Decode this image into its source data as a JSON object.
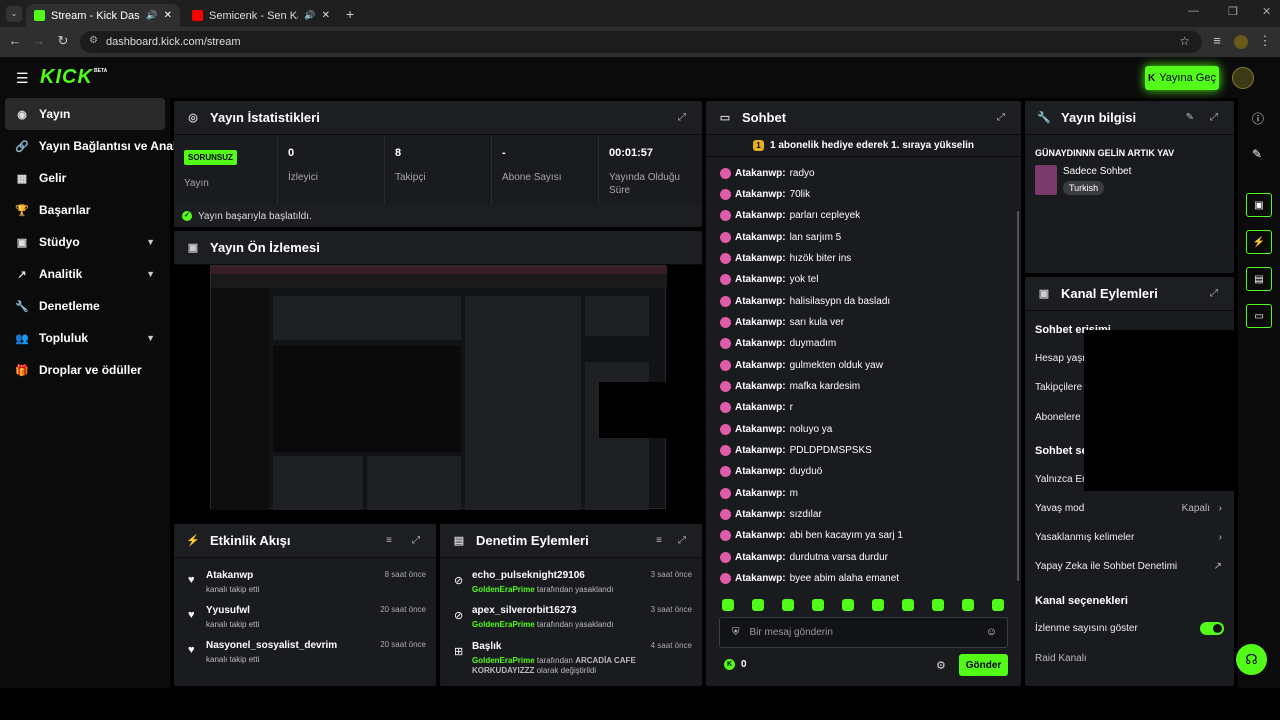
{
  "browser": {
    "tabs": [
      {
        "title": "Stream - Kick Dashboard",
        "favicon_color": "#53fc18"
      },
      {
        "title": "Semicenk - Sen Kaldın (Lyric",
        "favicon_color": "#ff0000"
      }
    ],
    "url": "dashboard.kick.com/stream"
  },
  "header": {
    "logo": "KICK",
    "beta": "BETA",
    "go_live": "Yayına Geç"
  },
  "sidebar": {
    "items": [
      {
        "label": "Yayın",
        "icon": "broadcast-icon"
      },
      {
        "label": "Yayın Bağlantısı ve Anahtarı",
        "icon": "link-icon"
      },
      {
        "label": "Gelir",
        "icon": "chart-icon"
      },
      {
        "label": "Başarılar",
        "icon": "trophy-icon"
      },
      {
        "label": "Stüdyo",
        "icon": "studio-icon"
      },
      {
        "label": "Analitik",
        "icon": "analytics-icon"
      },
      {
        "label": "Denetleme",
        "icon": "wrench-icon"
      },
      {
        "label": "Topluluk",
        "icon": "community-icon"
      },
      {
        "label": "Droplar ve ödüller",
        "icon": "gift-icon"
      }
    ]
  },
  "stats": {
    "title": "Yayın İstatistikleri",
    "status_badge": "SORUNSUZ",
    "status_label": "Yayın",
    "viewers_value": "0",
    "viewers_label": "İzleyici",
    "followers_value": "8",
    "followers_label": "Takipçi",
    "subs_value": "-",
    "subs_label": "Abone Sayısı",
    "uptime_value": "00:01:57",
    "uptime_label": "Yayında Olduğu Süre",
    "success_msg": "Yayın başarıyla başlatıldı."
  },
  "preview": {
    "title": "Yayın Ön İzlemesi"
  },
  "activity": {
    "title": "Etkinlik Akışı",
    "items": [
      {
        "name": "Atakanwp",
        "desc": "kanalı takip etti",
        "time": "8 saat önce"
      },
      {
        "name": "Yyusufwl",
        "desc": "kanalı takip etti",
        "time": "20 saat önce"
      },
      {
        "name": "Nasyonel_sosyalist_devrim",
        "desc": "kanalı takip etti",
        "time": "20 saat önce"
      }
    ]
  },
  "moderation": {
    "title": "Denetim Eylemleri",
    "items": [
      {
        "name": "echo_pulseknight29106",
        "by": "GoldenEraPrime",
        "desc": "tarafından yasaklandı",
        "time": "3 saat önce"
      },
      {
        "name": "apex_silverorbit16273",
        "by": "GoldenEraPrime",
        "desc": "tarafından yasaklandı",
        "time": "3 saat önce"
      },
      {
        "name": "Başlık",
        "by": "GoldenEraPrime",
        "desc": "tarafından",
        "extra": "ARCADİA CAFE KORKUDAYIZZZ",
        "extra2": "olarak değiştirildi",
        "time": "4 saat önce"
      }
    ]
  },
  "chat": {
    "title": "Sohbet",
    "banner": "1 abonelik hediye ederek 1. sıraya yükselin",
    "messages": [
      {
        "user": "Atakanwp:",
        "text": "radyo"
      },
      {
        "user": "Atakanwp:",
        "text": "70lik"
      },
      {
        "user": "Atakanwp:",
        "text": "parları cepleyek"
      },
      {
        "user": "Atakanwp:",
        "text": "lan sarjım 5"
      },
      {
        "user": "Atakanwp:",
        "text": "hızök biter ins"
      },
      {
        "user": "Atakanwp:",
        "text": "yok tel"
      },
      {
        "user": "Atakanwp:",
        "text": "halisilasypn da basladı"
      },
      {
        "user": "Atakanwp:",
        "text": "sarı kula ver"
      },
      {
        "user": "Atakanwp:",
        "text": "duymadım"
      },
      {
        "user": "Atakanwp:",
        "text": "gulmekten olduk yaw"
      },
      {
        "user": "Atakanwp:",
        "text": "mafka kardesim"
      },
      {
        "user": "Atakanwp:",
        "text": "r"
      },
      {
        "user": "Atakanwp:",
        "text": "noluyo ya"
      },
      {
        "user": "Atakanwp:",
        "text": "PDLDPDMSPSKS"
      },
      {
        "user": "Atakanwp:",
        "text": "duyduö"
      },
      {
        "user": "Atakanwp:",
        "text": "m"
      },
      {
        "user": "Atakanwp:",
        "text": "sızdılar"
      },
      {
        "user": "Atakanwp:",
        "text": "abi ben kacayım ya sarj 1"
      },
      {
        "user": "Atakanwp:",
        "text": "durdutna varsa durdur"
      },
      {
        "user": "Atakanwp:",
        "text": "byee abim alaha emanet"
      }
    ],
    "placeholder": "Bir mesaj gönderin",
    "points": "0",
    "send": "Gönder"
  },
  "info": {
    "title": "Yayın bilgisi",
    "stream_title": "GÜNAYDINNN GELİN ARTIK YAV",
    "category": "Sadece Sohbet",
    "language": "Turkish"
  },
  "channel": {
    "title": "Kanal Eylemleri",
    "chat_access": "Sohbet erişimi",
    "account_age": "Hesap yaşı",
    "followers": "Takipçilere",
    "subscribers": "Abonelere",
    "chat_options": "Sohbet se",
    "emotes_only": "Yalnızca Em",
    "slow_mode": "Yavaş mod",
    "slow_mode_value": "Kapalı",
    "banned_words": "Yasaklanmış kelimeler",
    "ai_moderation": "Yapay Zeka ile Sohbet Denetimi",
    "channel_options": "Kanal seçenekleri",
    "show_viewers": "İzlenme sayısını göster",
    "raid": "Raid Kanalı"
  },
  "colors": {
    "accent": "#53fc18",
    "panel": "#191b1f",
    "badge": "#e05ca8"
  }
}
